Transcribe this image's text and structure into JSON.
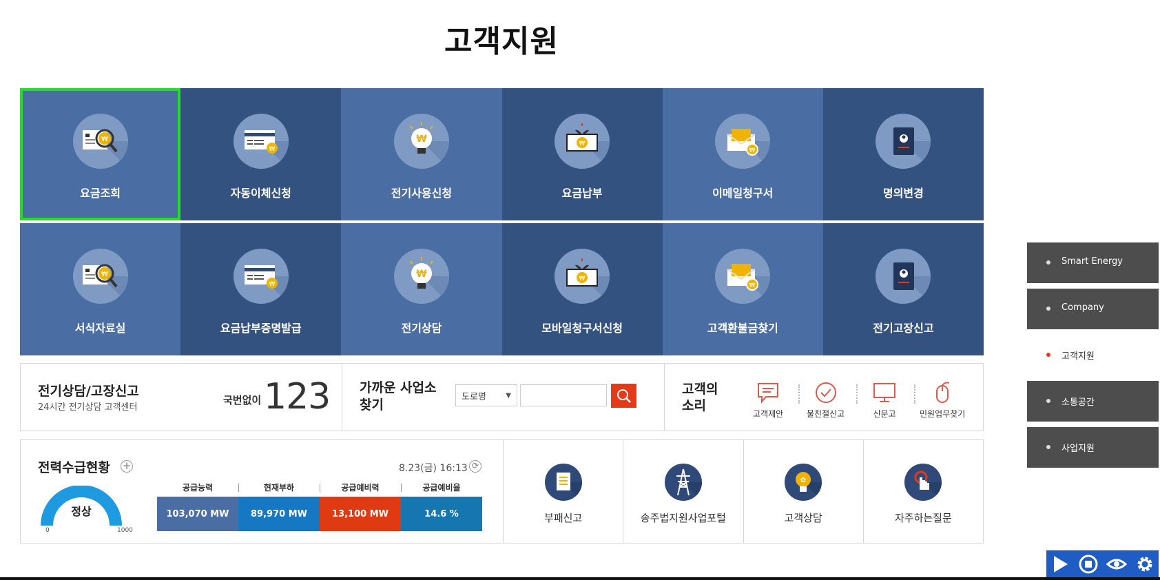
{
  "page": {
    "title": "고객지원"
  },
  "tiles": [
    {
      "label": "요금조회",
      "icon": "bill-search-icon"
    },
    {
      "label": "자동이체신청",
      "icon": "card-won-icon"
    },
    {
      "label": "전기사용신청",
      "icon": "lightbulb-won-icon"
    },
    {
      "label": "요금납부",
      "icon": "money-plant-icon"
    },
    {
      "label": "이메일청구서",
      "icon": "email-won-icon"
    },
    {
      "label": "명의변경",
      "icon": "passport-icon"
    },
    {
      "label": "서식자료실",
      "icon": "bill-search-icon"
    },
    {
      "label": "요금납부증명발급",
      "icon": "card-won-icon"
    },
    {
      "label": "전기상담",
      "icon": "lightbulb-won-icon"
    },
    {
      "label": "모바일청구서신청",
      "icon": "money-plant-icon"
    },
    {
      "label": "고객환불금찾기",
      "icon": "email-won-icon"
    },
    {
      "label": "전기고장신고",
      "icon": "passport-icon"
    }
  ],
  "call_center": {
    "title": "전기상담/고장신고",
    "subtitle": "24시간 전기상담 고객센터",
    "prefix": "국번없이",
    "number": "123"
  },
  "find_office": {
    "title": "가까운 사업소 찾기",
    "select_value": "도로명",
    "input_value": "",
    "search_icon": "search-icon"
  },
  "customer_voice": {
    "title": "고객의 소리",
    "items": [
      {
        "label": "고객제안",
        "icon": "speech-bubble-icon"
      },
      {
        "label": "불친절신고",
        "icon": "check-circle-icon"
      },
      {
        "label": "신문고",
        "icon": "monitor-icon"
      },
      {
        "label": "민원업무찾기",
        "icon": "mouse-icon"
      }
    ]
  },
  "power_status": {
    "title": "전력수급현황",
    "timestamp": "8.23(금) 16:13",
    "gauge": {
      "status": "정상",
      "min": "0",
      "max": "1000"
    },
    "headers": [
      "공급능력",
      "현재부하",
      "공급예비력",
      "공급예비율"
    ],
    "values": [
      "103,070 MW",
      "89,970 MW",
      "13,100 MW",
      "14.6 %"
    ],
    "colors": [
      "#4a6ea3",
      "#1677c2",
      "#e03a12",
      "#1677b0"
    ]
  },
  "quick_links": [
    {
      "label": "부패신고",
      "icon": "document-icon"
    },
    {
      "label": "송주법지원사업포털",
      "icon": "transmission-tower-icon"
    },
    {
      "label": "고객상담",
      "icon": "lightbulb-icon"
    },
    {
      "label": "자주하는질문",
      "icon": "hand-pointer-icon"
    }
  ],
  "side_menu": [
    {
      "label": "Smart Energy",
      "active": false
    },
    {
      "label": "Company",
      "active": false
    },
    {
      "label": "고객지원",
      "active": true
    },
    {
      "label": "소통공간",
      "active": false
    },
    {
      "label": "사업지원",
      "active": false
    }
  ],
  "player": {
    "buttons": [
      "play-icon",
      "stop-icon",
      "eye-icon",
      "gear-icon"
    ]
  },
  "colors": {
    "tile_light": "#4a6ea3",
    "tile_dark": "#34527f",
    "accent": "#e43a17",
    "selection": "#21e021"
  }
}
